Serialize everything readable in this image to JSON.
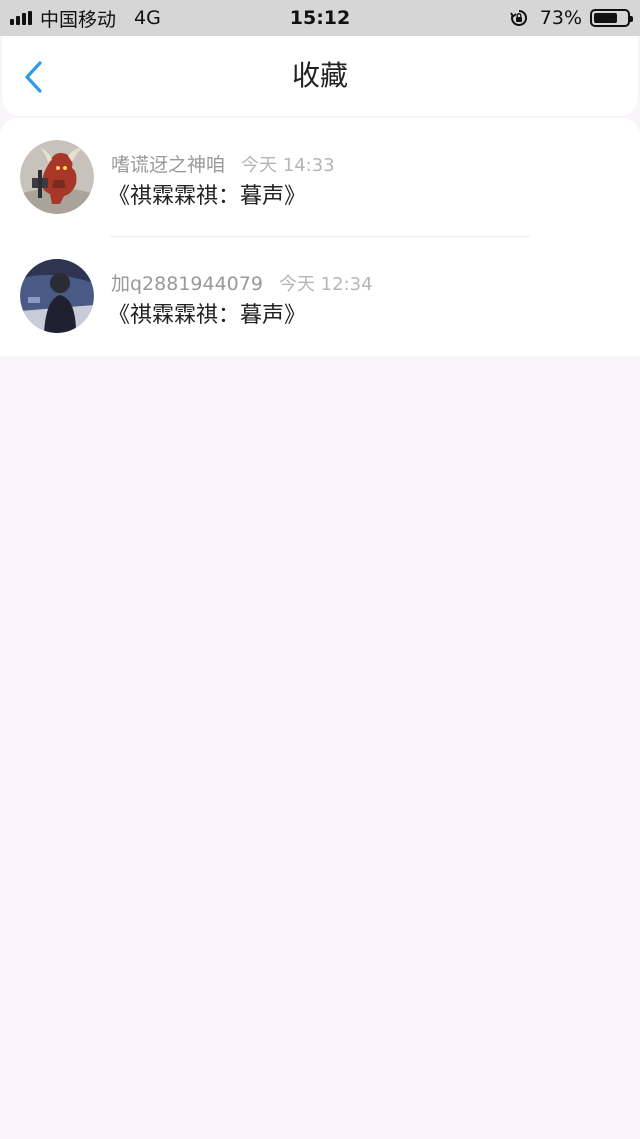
{
  "status_bar": {
    "carrier": "中国移动",
    "network": "4G",
    "time": "15:12",
    "battery_percent_label": "73%",
    "battery_level": 0.73
  },
  "header": {
    "title": "收藏",
    "back_icon": "chevron-left-icon",
    "accent_color": "#2f9be6"
  },
  "favorites": [
    {
      "user": "嗜谎迓之神咱",
      "time": "今天 14:33",
      "title": "《祺霖霖祺：暮声》",
      "avatar_icon": "avatar-warrior"
    },
    {
      "user": "加q2881944079",
      "time": "今天 12:34",
      "title": "《祺霖霖祺：暮声》",
      "avatar_icon": "avatar-person-photo"
    }
  ]
}
